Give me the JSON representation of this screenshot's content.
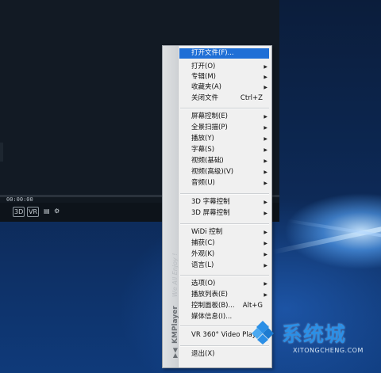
{
  "player": {
    "time": "00:00:00",
    "controls": [
      {
        "name": "3d-button",
        "label": "3D"
      },
      {
        "name": "vr-button",
        "label": "VR"
      },
      {
        "name": "subtitle-button",
        "label": "▤"
      },
      {
        "name": "settings-gear-icon",
        "label": "⚙"
      }
    ]
  },
  "menu": {
    "brand": "KMPlayer",
    "brand_tagline": "We All Enjoy !",
    "items": [
      {
        "label": "打开文件(F)...",
        "shortcut": "",
        "submenu": false,
        "highlighted": true
      },
      {
        "label": "打开(O)",
        "shortcut": "",
        "submenu": true
      },
      {
        "label": "专辑(M)",
        "shortcut": "",
        "submenu": true
      },
      {
        "label": "收藏夹(A)",
        "shortcut": "",
        "submenu": true
      },
      {
        "label": "关闭文件",
        "shortcut": "Ctrl+Z",
        "submenu": false
      },
      {
        "label": "屏幕控制(E)",
        "shortcut": "",
        "submenu": true
      },
      {
        "label": "全景扫描(P)",
        "shortcut": "",
        "submenu": true
      },
      {
        "label": "播放(Y)",
        "shortcut": "",
        "submenu": true
      },
      {
        "label": "字幕(S)",
        "shortcut": "",
        "submenu": true
      },
      {
        "label": "视频(基础)",
        "shortcut": "",
        "submenu": true
      },
      {
        "label": "视频(高级)(V)",
        "shortcut": "",
        "submenu": true
      },
      {
        "label": "音频(U)",
        "shortcut": "",
        "submenu": true
      },
      {
        "label": "3D 字幕控制",
        "shortcut": "",
        "submenu": true
      },
      {
        "label": "3D 屏幕控制",
        "shortcut": "",
        "submenu": true
      },
      {
        "label": "WiDi 控制",
        "shortcut": "",
        "submenu": true
      },
      {
        "label": "捕获(C)",
        "shortcut": "",
        "submenu": true
      },
      {
        "label": "外观(K)",
        "shortcut": "",
        "submenu": true
      },
      {
        "label": "语言(L)",
        "shortcut": "",
        "submenu": true
      },
      {
        "label": "选项(O)",
        "shortcut": "",
        "submenu": true
      },
      {
        "label": "播放列表(E)",
        "shortcut": "",
        "submenu": true
      },
      {
        "label": "控制面板(B)...",
        "shortcut": "Alt+G",
        "submenu": false
      },
      {
        "label": "媒体信息(I)...",
        "shortcut": "",
        "submenu": false
      },
      {
        "label": "VR 360° Video Play",
        "shortcut": "",
        "submenu": false
      },
      {
        "label": "退出(X)",
        "shortcut": "",
        "submenu": false
      }
    ]
  },
  "watermark": {
    "text": "系统城",
    "url": "XITONGCHENG.COM"
  },
  "colors": {
    "highlight": "#1f6fd6",
    "menu_bg": "#f0f0f0",
    "watermark": "#2b8fe6"
  }
}
